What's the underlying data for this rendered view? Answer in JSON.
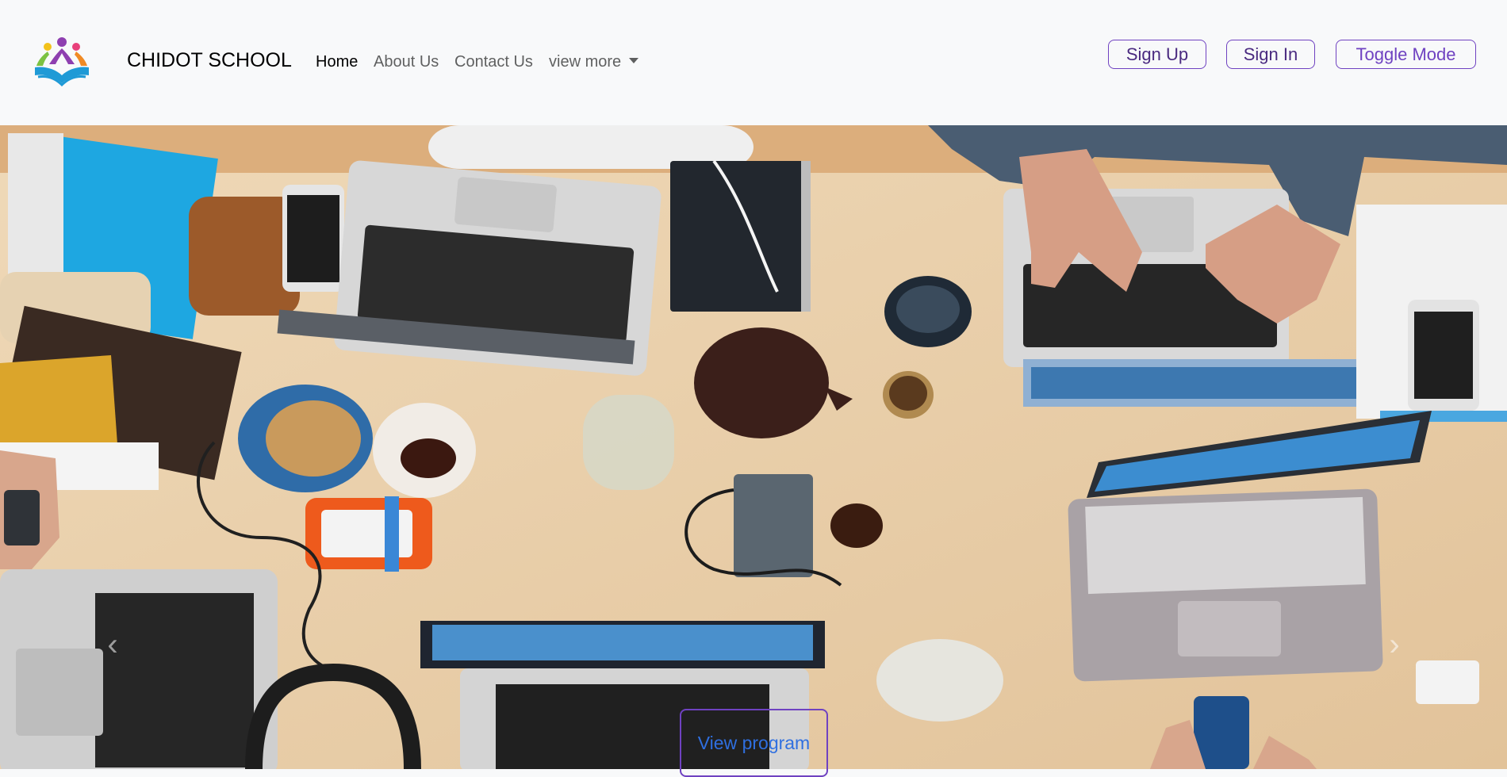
{
  "navbar": {
    "brand": "CHIDOT SCHOOL",
    "logo_icon": "school-logo-book-people",
    "links": [
      {
        "label": "Home",
        "active": true
      },
      {
        "label": "About Us",
        "active": false
      },
      {
        "label": "Contact Us",
        "active": false
      },
      {
        "label": "view more",
        "active": false,
        "dropdown": true
      }
    ],
    "buttons": {
      "sign_up": "Sign Up",
      "sign_in": "Sign In",
      "toggle_mode": "Toggle Mode"
    }
  },
  "hero": {
    "image": "workspace-desk-laptops-photo",
    "prev_icon": "chevron-left-icon",
    "next_icon": "chevron-right-icon",
    "cta_label": "View program"
  },
  "colors": {
    "accent": "#6f42c1",
    "cta_text": "#2f6fe0",
    "navbar_bg": "#f8f9fa",
    "desk": "#e9cfaa"
  }
}
